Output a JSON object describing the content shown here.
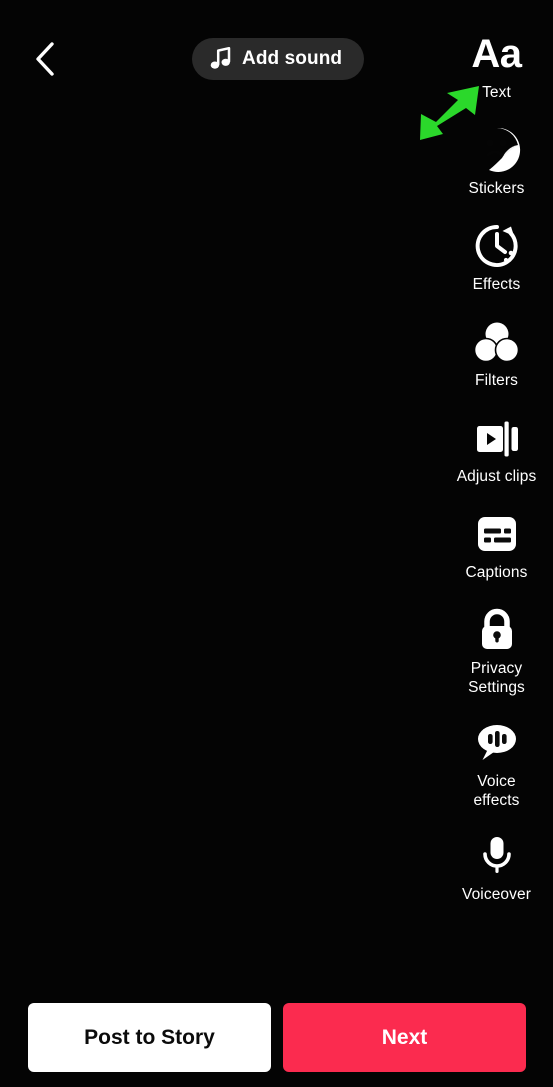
{
  "screen": {
    "name": "TikTok video editor / post screen",
    "background_color": "#040404"
  },
  "topbar": {
    "back_icon": "chevron-left-icon",
    "sound_button": {
      "label": "Add sound",
      "icon": "music-note-icon",
      "background_color": "#2a2a2a"
    }
  },
  "annotation": {
    "arrow_icon": "arrow-up-right-icon",
    "color": "#2BD82B",
    "points_at": "Text"
  },
  "tools": [
    {
      "label": "Text",
      "icon": "text-aa-icon"
    },
    {
      "label": "Stickers",
      "icon": "sticker-smiley-icon"
    },
    {
      "label": "Effects",
      "icon": "clock-rotate-icon"
    },
    {
      "label": "Filters",
      "icon": "three-circles-icon"
    },
    {
      "label": "Adjust clips",
      "icon": "clip-play-icon"
    },
    {
      "label": "Captions",
      "icon": "captions-bars-icon"
    },
    {
      "label": "Privacy\nSettings",
      "icon": "lock-icon"
    },
    {
      "label": "Voice\neffects",
      "icon": "speech-bubble-waveform-icon"
    },
    {
      "label": "Voiceover",
      "icon": "microphone-icon"
    }
  ],
  "bottombar": {
    "post_to_story": {
      "label": "Post to Story",
      "background_color": "#FFFFFF",
      "text_color": "#0B0B0B"
    },
    "next": {
      "label": "Next",
      "background_color": "#FB2B4F",
      "text_color": "#FFFFFF"
    }
  }
}
